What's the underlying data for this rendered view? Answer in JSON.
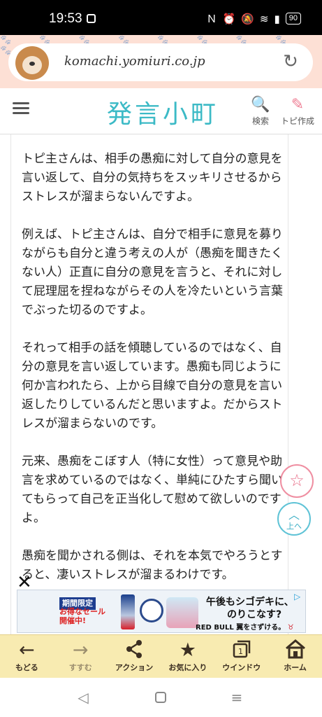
{
  "status_bar": {
    "time": "19:53",
    "battery": "90",
    "icons": [
      "nfc-icon",
      "alarm-icon",
      "mute-icon",
      "wifi-icon",
      "volte-icon",
      "signal-icon",
      "battery-icon"
    ]
  },
  "browser": {
    "url": "komachi.yomiuri.co.jp",
    "reload_icon": "reload-icon"
  },
  "header": {
    "logo": "発言小町",
    "search_label": "検索",
    "create_label": "トピ作成"
  },
  "article": {
    "paragraphs": [
      "トピ主さんは、相手の愚痴に対して自分の意見を言い返して、自分の気持ちをスッキリさせるからストレスが溜まらないんですよ。",
      "例えば、トピ主さんは、自分で相手に意見を募りながらも自分と違う考えの人が（愚痴を聞きたくない人）正直に自分の意見を言うと、それに対して屁理屈を捏ねながらその人を冷たいという言葉でぶった切るのですよ。",
      "それって相手の話を傾聴しているのではなく、自分の意見を言い返しています。愚痴も同じように何か言われたら、上から目線で自分の意見を言い返したりしているんだと思いますよ。だからストレスが溜まらないのです。",
      "元来、愚痴をこぼす人（特に女性）って意見や助言を求めているのではなく、単純にひたすら聞いてもらって自己を正当化して慰めて欲しいのですよ。",
      "愚痴を聞かされる側は、それを本気でやろうとすると、凄いストレスが溜まるわけです。"
    ]
  },
  "floating": {
    "favorite_icon": "☆",
    "top_label": "上へ"
  },
  "ad": {
    "left_line1": "期間限定",
    "left_line2": "お得なセール",
    "left_line3": "開催中!",
    "right_line1": "午後もシゴデキに、",
    "right_line2": "のりこなす?",
    "right_line3_brand": "RED BULL",
    "right_line3_rest": " 翼をさずける。",
    "close": "✕"
  },
  "toolbar": {
    "items": [
      {
        "label": "もどる",
        "icon": "←"
      },
      {
        "label": "すすむ",
        "icon": "→"
      },
      {
        "label": "アクション",
        "icon": "share"
      },
      {
        "label": "お気に入り",
        "icon": "★"
      },
      {
        "label": "ウインドウ",
        "icon": "window"
      },
      {
        "label": "ホーム",
        "icon": "home"
      }
    ]
  }
}
